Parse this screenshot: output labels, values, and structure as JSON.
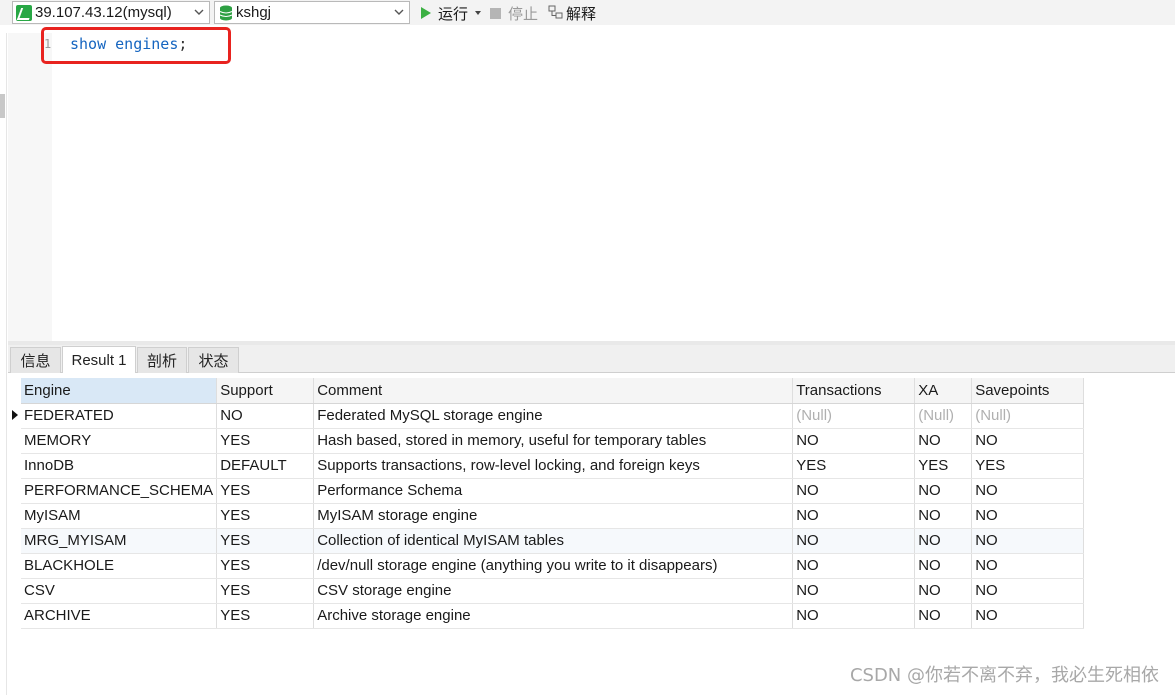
{
  "toolbar": {
    "connection": "39.107.43.12(mysql)",
    "database": "kshgj",
    "run_label": "运行",
    "stop_label": "停止",
    "explain_label": "解释"
  },
  "editor": {
    "line_number": "1",
    "code_keyword": "show engines",
    "code_semicolon": ";"
  },
  "tabs": [
    "信息",
    "Result 1",
    "剖析",
    "状态"
  ],
  "result": {
    "columns": [
      "Engine",
      "Support",
      "Comment",
      "Transactions",
      "XA",
      "Savepoints"
    ],
    "rows": [
      [
        "FEDERATED",
        "NO",
        "Federated MySQL storage engine",
        "(Null)",
        "(Null)",
        "(Null)"
      ],
      [
        "MEMORY",
        "YES",
        "Hash based, stored in memory, useful for temporary tables",
        "NO",
        "NO",
        "NO"
      ],
      [
        "InnoDB",
        "DEFAULT",
        "Supports transactions, row-level locking, and foreign keys",
        "YES",
        "YES",
        "YES"
      ],
      [
        "PERFORMANCE_SCHEMA",
        "YES",
        "Performance Schema",
        "NO",
        "NO",
        "NO"
      ],
      [
        "MyISAM",
        "YES",
        "MyISAM storage engine",
        "NO",
        "NO",
        "NO"
      ],
      [
        "MRG_MYISAM",
        "YES",
        "Collection of identical MyISAM tables",
        "NO",
        "NO",
        "NO"
      ],
      [
        "BLACKHOLE",
        "YES",
        "/dev/null storage engine (anything you write to it disappears)",
        "NO",
        "NO",
        "NO"
      ],
      [
        "CSV",
        "YES",
        "CSV storage engine",
        "NO",
        "NO",
        "NO"
      ],
      [
        "ARCHIVE",
        "YES",
        "Archive storage engine",
        "NO",
        "NO",
        "NO"
      ]
    ]
  },
  "watermark": "CSDN @你若不离不弃，我必生死相依",
  "colors": {
    "highlight_border": "#e8231f",
    "keyword": "#1565c0",
    "run_icon": "#3cb043"
  }
}
